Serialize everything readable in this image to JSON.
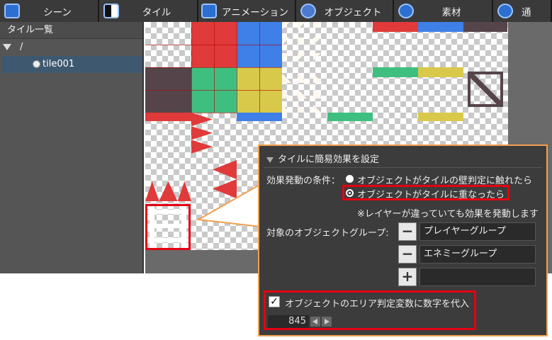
{
  "tabs": [
    {
      "label": "シーン",
      "icon": "scene-icon"
    },
    {
      "label": "タイル",
      "icon": "tile-icon"
    },
    {
      "label": "アニメーション",
      "icon": "animation-icon"
    },
    {
      "label": "オブジェクト",
      "icon": "object-icon"
    },
    {
      "label": "素材",
      "icon": "material-icon"
    },
    {
      "label": "通",
      "icon": "communication-icon"
    }
  ],
  "sidebar": {
    "title": "タイル一覧",
    "root": "/",
    "items": [
      {
        "label": "tile001",
        "selected": true
      }
    ]
  },
  "callout": {
    "title": "タイルに簡易効果を設定",
    "condition_label": "効果発動の条件：",
    "options": [
      {
        "label": "オブジェクトがタイルの壁判定に触れたら",
        "selected": false
      },
      {
        "label": "オブジェクトがタイルに重なったら",
        "selected": true
      }
    ],
    "note": "※レイヤーが違っていても効果を発動します",
    "group_label": "対象のオブジェクトグループ:",
    "groups": [
      "プレイヤーグループ",
      "エネミーグループ",
      ""
    ],
    "checkbox_label": "オブジェクトのエリア判定変数に数字を代入",
    "checkbox_checked": true,
    "number_value": "845"
  },
  "colors": {
    "highlight": "#e60012",
    "callout_border": "#f0a050",
    "tile_red": "#e03a3a",
    "tile_blue": "#3f7fe8",
    "tile_green": "#3fbf7f",
    "tile_yellow": "#d8c94a",
    "tile_dark": "#55454a",
    "selection": "#3e5870"
  }
}
